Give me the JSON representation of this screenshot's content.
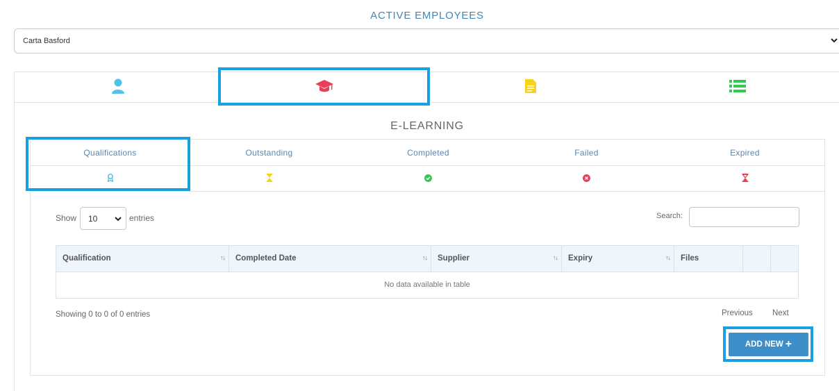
{
  "page": {
    "title": "ACTIVE EMPLOYEES"
  },
  "employee_select": {
    "value": "Carta Basford",
    "icon": "chevron-down-icon"
  },
  "main_tabs": [
    {
      "icon": "user-icon",
      "color": "#4fc3e8"
    },
    {
      "icon": "graduation-cap-icon",
      "color": "#e8405a",
      "active": true
    },
    {
      "icon": "document-icon",
      "color": "#f6d31f"
    },
    {
      "icon": "list-icon",
      "color": "#2fcb4e"
    }
  ],
  "section": {
    "title": "E-LEARNING"
  },
  "sub_tabs": [
    {
      "label": "Qualifications",
      "icon": "award-icon",
      "color": "#4fc3e8",
      "active": true
    },
    {
      "label": "Outstanding",
      "icon": "hourglass-icon",
      "color": "#f6d31f"
    },
    {
      "label": "Completed",
      "icon": "check-circle-icon",
      "color": "#2fcb4e"
    },
    {
      "label": "Failed",
      "icon": "times-circle-icon",
      "color": "#e8405a"
    },
    {
      "label": "Expired",
      "icon": "hourglass-end-icon",
      "color": "#e8405a"
    }
  ],
  "table_controls": {
    "show_label": "Show",
    "entries_label": "entries",
    "page_length": "10",
    "search_label": "Search:",
    "search_value": ""
  },
  "table": {
    "columns": [
      "Qualification",
      "Completed Date",
      "Supplier",
      "Expiry",
      "Files",
      "",
      ""
    ],
    "empty_message": "No data available in table"
  },
  "pagination": {
    "info": "Showing 0 to 0 of 0 entries",
    "previous": "Previous",
    "next": "Next"
  },
  "actions": {
    "add_new": "ADD NEW"
  },
  "colors": {
    "accent": "#3d87b9",
    "highlight": "#1a9fe0",
    "button": "#3d8ec9"
  }
}
